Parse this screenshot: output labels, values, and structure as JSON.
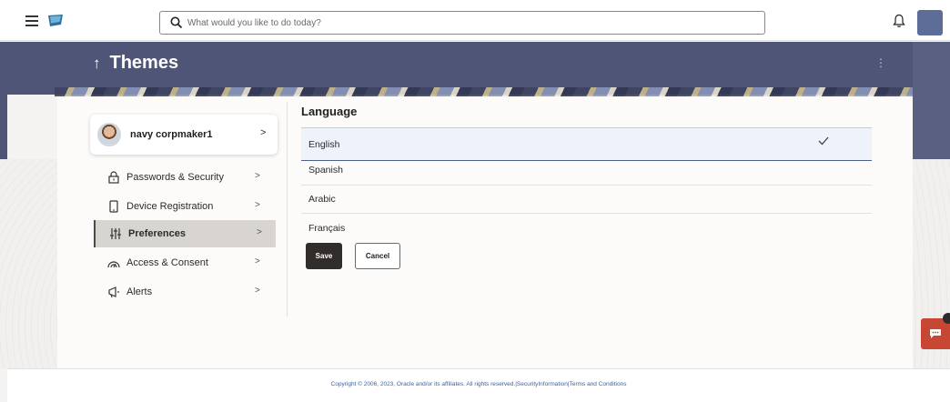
{
  "header": {
    "search_placeholder": "What would you like to do today?"
  },
  "page": {
    "title": "Themes"
  },
  "profile": {
    "name": "navy corpmaker1"
  },
  "nav": {
    "items": [
      {
        "label": "Passwords & Security",
        "icon": "lock-icon"
      },
      {
        "label": "Device Registration",
        "icon": "device-icon"
      },
      {
        "label": "Preferences",
        "icon": "sliders-icon",
        "active": true
      },
      {
        "label": "Access & Consent",
        "icon": "access-icon"
      },
      {
        "label": "Alerts",
        "icon": "megaphone-icon"
      }
    ]
  },
  "language": {
    "title": "Language",
    "options": [
      {
        "label": "English",
        "selected": true
      },
      {
        "label": "Spanish",
        "selected": false
      },
      {
        "label": "Arabic",
        "selected": false
      },
      {
        "label": "Français",
        "selected": false
      }
    ]
  },
  "actions": {
    "save_label": "Save",
    "cancel_label": "Cancel"
  },
  "footer": {
    "text": "Copyright © 2006, 2023, Oracle and/or its affiliates. All rights reserved.|SecurityInformation|Terms and Conditions"
  },
  "colors": {
    "banner": "#4e5576",
    "accent_chat": "#c74634",
    "primary_button": "#312d2a"
  }
}
